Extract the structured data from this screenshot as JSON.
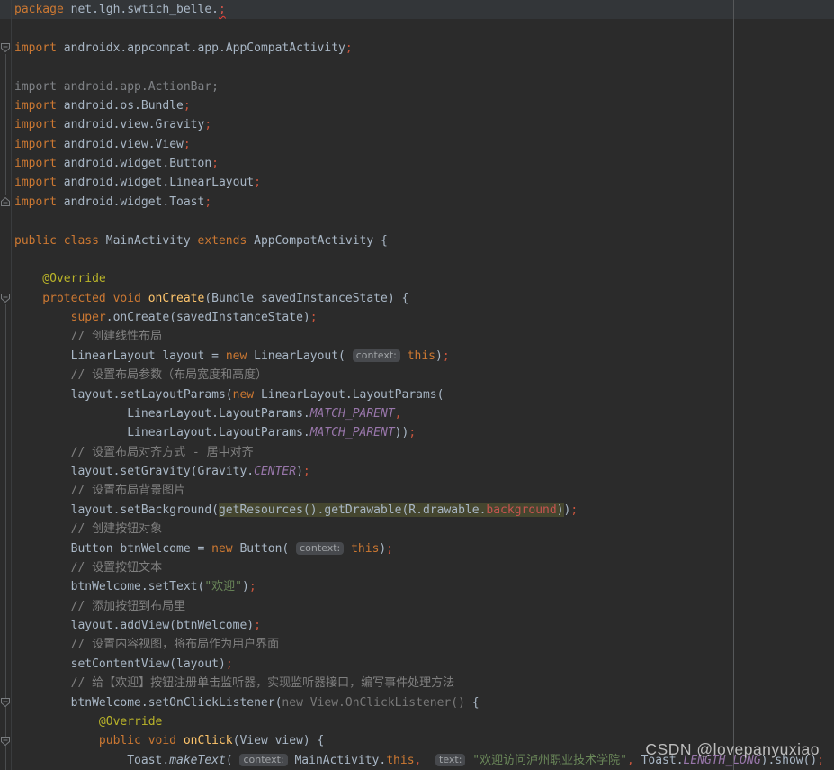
{
  "editor": {
    "watermark": "CSDN @lovepanyuxiao",
    "colors": {
      "background": "#2b2b2b",
      "caret_line": "#333639",
      "keyword": "#cc7832",
      "default_text": "#a9b7c6",
      "comment": "#808080",
      "annotation": "#bbb529",
      "method_decl": "#fec56c",
      "string": "#6a8759",
      "constant": "#9876aa",
      "semicolon": "#c8553d",
      "error": "#d5554a",
      "warning_highlight_bg": "#45462f",
      "inlay_hint_bg": "#47494d",
      "margin_guide": "#56585a"
    },
    "fold_guides": [
      {
        "from": 3,
        "to": 11
      },
      {
        "from": 16,
        "to": 41
      }
    ],
    "lines": [
      {
        "caret": true,
        "t": [
          [
            "kw",
            "package"
          ],
          [
            "def",
            " net.lgh.swtich_belle."
          ],
          [
            "err",
            ";"
          ]
        ]
      },
      {
        "t": []
      },
      {
        "fold": "down",
        "t": [
          [
            "kw",
            "import"
          ],
          [
            "def",
            " androidx.appcompat.app.AppCompatActivity"
          ],
          [
            "sc",
            ";"
          ]
        ]
      },
      {
        "t": []
      },
      {
        "t": [
          [
            "gray",
            "import android.app.ActionBar;"
          ]
        ]
      },
      {
        "t": [
          [
            "kw",
            "import"
          ],
          [
            "def",
            " android.os.Bundle"
          ],
          [
            "sc",
            ";"
          ]
        ]
      },
      {
        "t": [
          [
            "kw",
            "import"
          ],
          [
            "def",
            " android.view.Gravity"
          ],
          [
            "sc",
            ";"
          ]
        ]
      },
      {
        "t": [
          [
            "kw",
            "import"
          ],
          [
            "def",
            " android.view.View"
          ],
          [
            "sc",
            ";"
          ]
        ]
      },
      {
        "t": [
          [
            "kw",
            "import"
          ],
          [
            "def",
            " android.widget.Button"
          ],
          [
            "sc",
            ";"
          ]
        ]
      },
      {
        "t": [
          [
            "kw",
            "import"
          ],
          [
            "def",
            " android.widget.LinearLayout"
          ],
          [
            "sc",
            ";"
          ]
        ]
      },
      {
        "fold": "up",
        "t": [
          [
            "kw",
            "import"
          ],
          [
            "def",
            " android.widget.Toast"
          ],
          [
            "sc",
            ";"
          ]
        ]
      },
      {
        "t": []
      },
      {
        "t": [
          [
            "kw",
            "public class"
          ],
          [
            "def",
            " MainActivity "
          ],
          [
            "kw",
            "extends"
          ],
          [
            "def",
            " AppCompatActivity {"
          ]
        ]
      },
      {
        "t": []
      },
      {
        "t": [
          [
            "ann",
            "    @Override"
          ]
        ]
      },
      {
        "fold": "down",
        "t": [
          [
            "kw",
            "    protected void "
          ],
          [
            "mth",
            "onCreate"
          ],
          [
            "def",
            "(Bundle savedInstanceState) {"
          ]
        ]
      },
      {
        "t": [
          [
            "def",
            "        "
          ],
          [
            "kw",
            "super"
          ],
          [
            "def",
            ".onCreate(savedInstanceState)"
          ],
          [
            "sc",
            ";"
          ]
        ]
      },
      {
        "t": [
          [
            "cmt",
            "        // 创建线性布局"
          ]
        ]
      },
      {
        "t": [
          [
            "def",
            "        LinearLayout layout = "
          ],
          [
            "kw",
            "new"
          ],
          [
            "def",
            " LinearLayout( "
          ],
          [
            "hint",
            "context:"
          ],
          [
            "def",
            " "
          ],
          [
            "kw",
            "this"
          ],
          [
            "def",
            ")"
          ],
          [
            "sc",
            ";"
          ]
        ]
      },
      {
        "t": [
          [
            "cmt",
            "        // 设置布局参数（布局宽度和高度）"
          ]
        ]
      },
      {
        "t": [
          [
            "def",
            "        layout.setLayoutParams("
          ],
          [
            "kw",
            "new"
          ],
          [
            "def",
            " LinearLayout.LayoutParams("
          ]
        ]
      },
      {
        "t": [
          [
            "def",
            "                LinearLayout.LayoutParams."
          ],
          [
            "cst",
            "MATCH_PARENT"
          ],
          [
            "sc",
            ","
          ]
        ]
      },
      {
        "t": [
          [
            "def",
            "                LinearLayout.LayoutParams."
          ],
          [
            "cst",
            "MATCH_PARENT"
          ],
          [
            "def",
            "))"
          ],
          [
            "sc",
            ";"
          ]
        ]
      },
      {
        "t": [
          [
            "cmt",
            "        // 设置布局对齐方式 - 居中对齐"
          ]
        ]
      },
      {
        "t": [
          [
            "def",
            "        layout.setGravity(Gravity."
          ],
          [
            "cst",
            "CENTER"
          ],
          [
            "def",
            ")"
          ],
          [
            "sc",
            ";"
          ]
        ]
      },
      {
        "t": [
          [
            "cmt",
            "        // 设置布局背景图片"
          ]
        ]
      },
      {
        "t": [
          [
            "def",
            "        layout.setBackground("
          ],
          [
            "def hl",
            "getResources().getDrawable(R.drawable."
          ],
          [
            "errres hl",
            "background"
          ],
          [
            "def hl",
            ")"
          ],
          [
            "def",
            ")"
          ],
          [
            "sc",
            ";"
          ]
        ]
      },
      {
        "t": [
          [
            "cmt",
            "        // 创建按钮对象"
          ]
        ]
      },
      {
        "t": [
          [
            "def",
            "        Button btnWelcome = "
          ],
          [
            "kw",
            "new"
          ],
          [
            "def",
            " Button( "
          ],
          [
            "hint",
            "context:"
          ],
          [
            "def",
            " "
          ],
          [
            "kw",
            "this"
          ],
          [
            "def",
            ")"
          ],
          [
            "sc",
            ";"
          ]
        ]
      },
      {
        "t": [
          [
            "cmt",
            "        // 设置按钮文本"
          ]
        ]
      },
      {
        "t": [
          [
            "def",
            "        btnWelcome.setText("
          ],
          [
            "str",
            "\"欢迎\""
          ],
          [
            "def",
            ")"
          ],
          [
            "sc",
            ";"
          ]
        ]
      },
      {
        "t": [
          [
            "cmt",
            "        // 添加按钮到布局里"
          ]
        ]
      },
      {
        "t": [
          [
            "def",
            "        layout.addView(btnWelcome)"
          ],
          [
            "sc",
            ";"
          ]
        ]
      },
      {
        "t": [
          [
            "cmt",
            "        // 设置内容视图，将布局作为用户界面"
          ]
        ]
      },
      {
        "t": [
          [
            "def",
            "        setContentView(layout)"
          ],
          [
            "sc",
            ";"
          ]
        ]
      },
      {
        "t": [
          [
            "cmt",
            "        // 给【欢迎】按钮注册单击监听器，实现监听器接口，编写事件处理方法"
          ]
        ]
      },
      {
        "fold": "down",
        "t": [
          [
            "def",
            "        btnWelcome.setOnClickListener("
          ],
          [
            "dim",
            "new View.OnClickListener() "
          ],
          [
            "def",
            "{"
          ]
        ]
      },
      {
        "t": [
          [
            "ann",
            "            @Override"
          ]
        ]
      },
      {
        "fold": "down",
        "t": [
          [
            "kw",
            "            public void "
          ],
          [
            "mth",
            "onClick"
          ],
          [
            "def",
            "(View view) {"
          ]
        ]
      },
      {
        "t": [
          [
            "def",
            "                Toast."
          ],
          [
            "itl",
            "makeText"
          ],
          [
            "def",
            "( "
          ],
          [
            "hint",
            "context:"
          ],
          [
            "def",
            " MainActivity."
          ],
          [
            "kw",
            "this"
          ],
          [
            "sc",
            ","
          ],
          [
            "def",
            "  "
          ],
          [
            "hint",
            "text:"
          ],
          [
            "def",
            " "
          ],
          [
            "str",
            "\"欢迎访问泸州职业技术学院\""
          ],
          [
            "sc",
            ","
          ],
          [
            "def",
            " Toast."
          ],
          [
            "cst",
            "LENGTH_LONG"
          ],
          [
            "def",
            ").show()"
          ],
          [
            "sc",
            ";"
          ]
        ]
      }
    ]
  }
}
